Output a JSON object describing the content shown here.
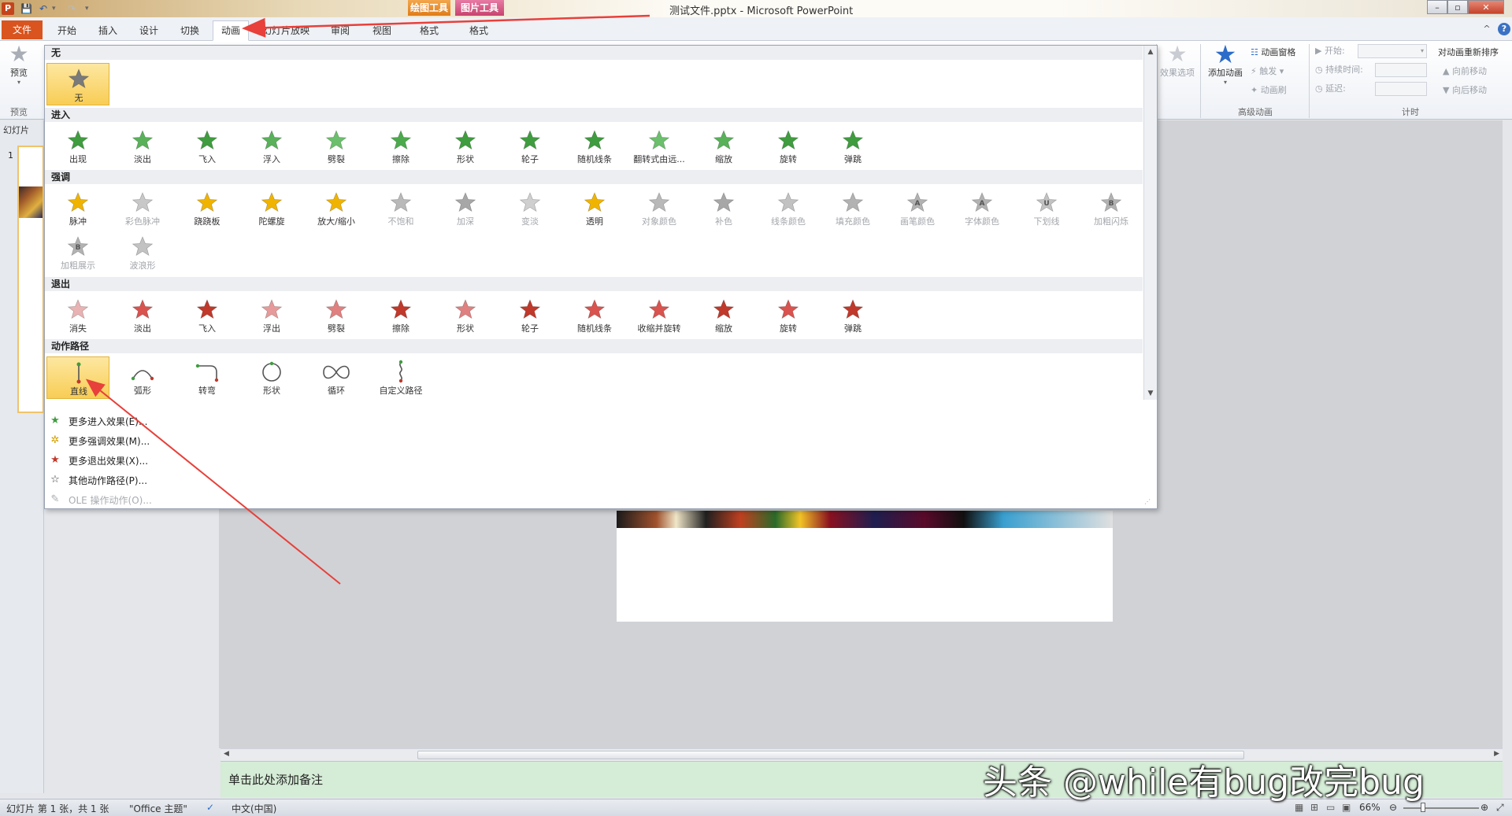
{
  "window": {
    "title": "测试文件.pptx - Microsoft PowerPoint",
    "app_icon": "P",
    "context_tabs": [
      "绘图工具",
      "图片工具"
    ],
    "controls": {
      "minimize": "–",
      "maximize": "▫",
      "close": "✕"
    }
  },
  "quick_access": {
    "icons": [
      "ppt-icon",
      "save-icon",
      "undo-icon",
      "redo-icon",
      "customize-icon"
    ]
  },
  "ribbon_tabs": [
    "文件",
    "开始",
    "插入",
    "设计",
    "切换",
    "动画",
    "幻灯片放映",
    "审阅",
    "视图",
    "格式",
    "格式"
  ],
  "active_tab": "动画",
  "ribbon": {
    "preview": {
      "label": "预览",
      "group": "预览"
    },
    "effect_options": "效果选项",
    "add_animation": "添加动画",
    "animation_pane": "动画窗格",
    "trigger": "触发",
    "animation_painter": "动画刷",
    "advanced_group": "高级动画",
    "start_label": "开始:",
    "duration_label": "持续时间:",
    "delay_label": "延迟:",
    "timing_group": "计时",
    "reorder_title": "对动画重新排序",
    "move_earlier": "向前移动",
    "move_later": "向后移动"
  },
  "left_panel": {
    "tab": "幻灯片",
    "slide_number": "1"
  },
  "gallery": {
    "sections": [
      {
        "title": "无",
        "items": [
          {
            "label": "无",
            "color": "#7a7a7a",
            "selected": true
          }
        ]
      },
      {
        "title": "进入",
        "items": [
          {
            "label": "出现",
            "color": "#3f9c3f"
          },
          {
            "label": "淡出",
            "color": "#59b159"
          },
          {
            "label": "飞入",
            "color": "#3f9c3f"
          },
          {
            "label": "浮入",
            "color": "#59b159"
          },
          {
            "label": "劈裂",
            "color": "#6cbf6c"
          },
          {
            "label": "擦除",
            "color": "#4caa4c"
          },
          {
            "label": "形状",
            "color": "#3f9c3f"
          },
          {
            "label": "轮子",
            "color": "#3f9c3f"
          },
          {
            "label": "随机线条",
            "color": "#3f9c3f"
          },
          {
            "label": "翻转式由远...",
            "color": "#6cbf6c"
          },
          {
            "label": "缩放",
            "color": "#59b159"
          },
          {
            "label": "旋转",
            "color": "#3f9c3f"
          },
          {
            "label": "弹跳",
            "color": "#3f9c3f"
          }
        ]
      },
      {
        "title": "强调",
        "items": [
          {
            "label": "脉冲",
            "color": "#f0b400"
          },
          {
            "label": "彩色脉冲",
            "color": "#c8c8c8",
            "dim": true
          },
          {
            "label": "跷跷板",
            "color": "#f0b400"
          },
          {
            "label": "陀螺旋",
            "color": "#f0b400"
          },
          {
            "label": "放大/缩小",
            "color": "#f0b400"
          },
          {
            "label": "不饱和",
            "color": "#b9b9b9",
            "dim": true
          },
          {
            "label": "加深",
            "color": "#a7a7a7",
            "dim": true
          },
          {
            "label": "变淡",
            "color": "#cfcfcf",
            "dim": true
          },
          {
            "label": "透明",
            "color": "#f0b400"
          },
          {
            "label": "对象颜色",
            "color": "#b9b9b9",
            "dim": true
          },
          {
            "label": "补色",
            "color": "#a7a7a7",
            "dim": true
          },
          {
            "label": "线条颜色",
            "color": "#c2c2c2",
            "dim": true
          },
          {
            "label": "填充颜色",
            "color": "#b2b2b2",
            "dim": true
          },
          {
            "label": "画笔颜色",
            "color": "#b2b2b2",
            "dim": true,
            "glyph": "A"
          },
          {
            "label": "字体颜色",
            "color": "#b2b2b2",
            "dim": true,
            "glyph": "A"
          },
          {
            "label": "下划线",
            "color": "#c2c2c2",
            "dim": true,
            "glyph": "U"
          },
          {
            "label": "加粗闪烁",
            "color": "#b2b2b2",
            "dim": true,
            "glyph": "B"
          },
          {
            "label": "加粗展示",
            "color": "#b2b2b2",
            "dim": true,
            "glyph": "B"
          },
          {
            "label": "波浪形",
            "color": "#c2c2c2",
            "dim": true
          }
        ]
      },
      {
        "title": "退出",
        "items": [
          {
            "label": "消失",
            "color": "#e9b3b3"
          },
          {
            "label": "淡出",
            "color": "#d9534f"
          },
          {
            "label": "飞入",
            "color": "#c0392b"
          },
          {
            "label": "浮出",
            "color": "#e79a9a"
          },
          {
            "label": "劈裂",
            "color": "#e08080"
          },
          {
            "label": "擦除",
            "color": "#c0392b"
          },
          {
            "label": "形状",
            "color": "#e08080"
          },
          {
            "label": "轮子",
            "color": "#c0392b"
          },
          {
            "label": "随机线条",
            "color": "#d9534f"
          },
          {
            "label": "收缩并旋转",
            "color": "#d9534f"
          },
          {
            "label": "缩放",
            "color": "#c0392b"
          },
          {
            "label": "旋转",
            "color": "#d9534f"
          },
          {
            "label": "弹跳",
            "color": "#c0392b"
          }
        ]
      },
      {
        "title": "动作路径",
        "items": [
          {
            "label": "直线",
            "color": "#3f9c3f",
            "path": "line",
            "selected": true
          },
          {
            "label": "弧形",
            "color": "#555555",
            "path": "arc"
          },
          {
            "label": "转弯",
            "color": "#555555",
            "path": "turn"
          },
          {
            "label": "形状",
            "color": "#555555",
            "path": "circle"
          },
          {
            "label": "循环",
            "color": "#555555",
            "path": "loop"
          },
          {
            "label": "自定义路径",
            "color": "#555555",
            "path": "custom"
          }
        ]
      }
    ],
    "menu": [
      {
        "label": "更多进入效果(E)...",
        "icon": "★",
        "color": "#3f9c3f"
      },
      {
        "label": "更多强调效果(M)...",
        "icon": "✲",
        "color": "#d4a000"
      },
      {
        "label": "更多退出效果(X)...",
        "icon": "★",
        "color": "#c0392b"
      },
      {
        "label": "其他动作路径(P)...",
        "icon": "☆",
        "color": "#333333"
      },
      {
        "label": "OLE 操作动作(O)...",
        "icon": "✎",
        "color": "#a8abb0",
        "dim": true
      }
    ]
  },
  "notes": {
    "placeholder": "单击此处添加备注"
  },
  "status": {
    "slide": "幻灯片 第 1 张，共 1 张",
    "theme": "\"Office 主题\"",
    "language": "中文(中国)",
    "zoom": "66%"
  },
  "watermark": "头条 @while有bug改完bug",
  "colors": {
    "accent": "#d9541e",
    "annotation_arrow": "#e8403a",
    "selected_fill": "#f8cd55"
  }
}
